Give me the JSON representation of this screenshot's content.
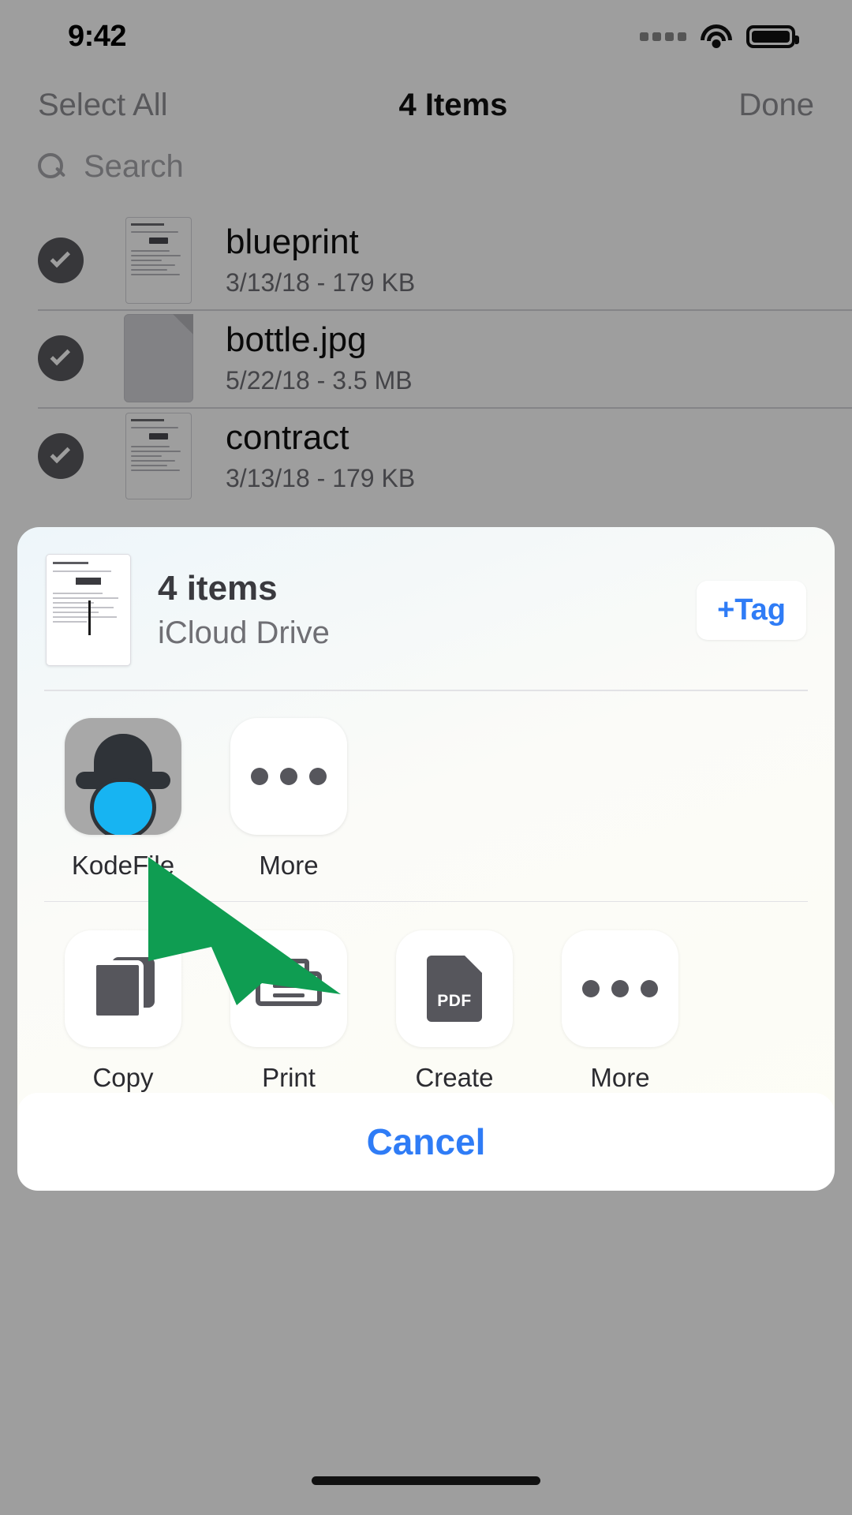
{
  "status_bar": {
    "time": "9:42",
    "signal_icon": "cellular-signal-icon",
    "wifi_icon": "wifi-icon",
    "battery_icon": "battery-icon"
  },
  "nav_bar": {
    "select_all_label": "Select All",
    "title": "4 Items",
    "done_label": "Done"
  },
  "search": {
    "placeholder": "Search",
    "icon": "search-icon"
  },
  "file_list": [
    {
      "name": "blueprint",
      "meta": "3/13/18 - 179 KB",
      "selected": true,
      "thumb": "document-preview"
    },
    {
      "name": "bottle.jpg",
      "meta": "5/22/18 - 3.5 MB",
      "selected": true,
      "thumb": "blank-file"
    },
    {
      "name": "contract",
      "meta": "3/13/18 - 179 KB",
      "selected": true,
      "thumb": "document-preview"
    }
  ],
  "share_sheet": {
    "title": "4 items",
    "subtitle": "iCloud Drive",
    "tag_button_label": "+Tag",
    "thumbnail": "document-preview",
    "apps": [
      {
        "label": "KodeFile",
        "icon": "kodefile-app-icon"
      },
      {
        "label": "More",
        "icon": "ellipsis-icon"
      }
    ],
    "actions": [
      {
        "label": "Copy",
        "icon": "copy-icon"
      },
      {
        "label": "Print",
        "icon": "printer-icon"
      },
      {
        "label": "Create PDF",
        "icon": "pdf-icon",
        "badge": "PDF"
      },
      {
        "label": "More",
        "icon": "ellipsis-icon"
      }
    ]
  },
  "cancel_button": {
    "label": "Cancel"
  },
  "cursor": {
    "icon": "green-arrow-cursor",
    "color": "#0f9d52"
  },
  "colors": {
    "accent_blue": "#2f7cf6",
    "cursor_green": "#0f9d52",
    "kodefile_blue": "#17b4f2",
    "kodefile_dark": "#2f3338",
    "sheet_bg": "#fbfbf8"
  }
}
